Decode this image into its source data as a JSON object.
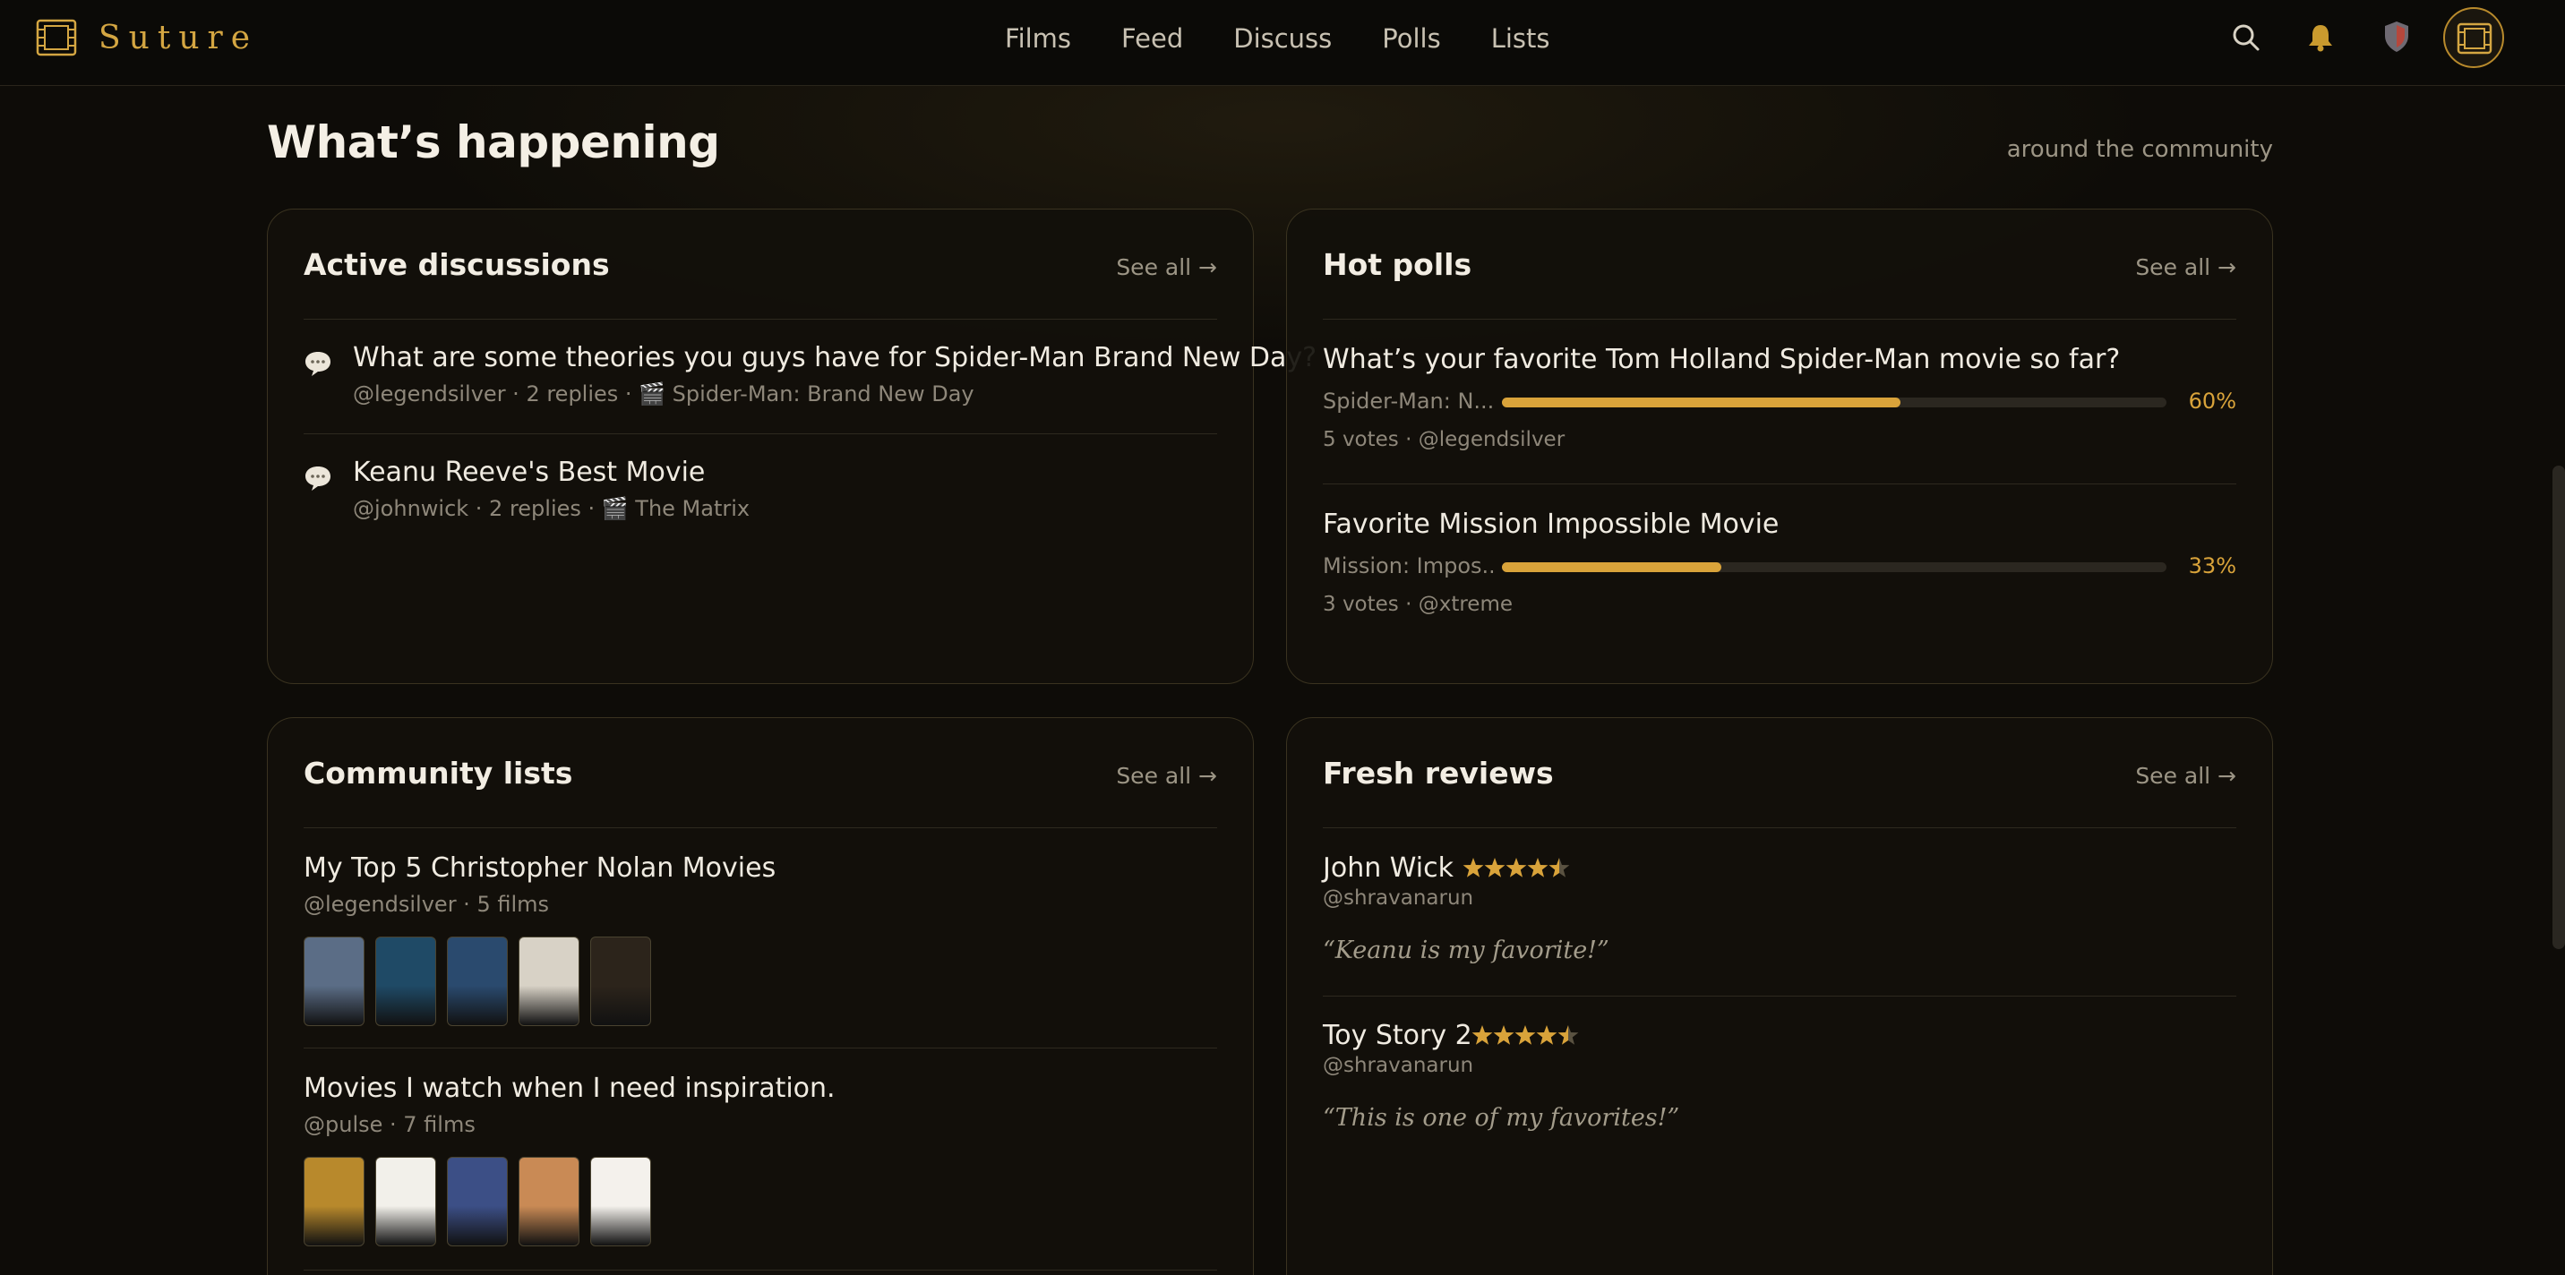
{
  "app": {
    "name": "Suture"
  },
  "nav": {
    "items": [
      "Films",
      "Feed",
      "Discuss",
      "Polls",
      "Lists"
    ]
  },
  "header_icons": [
    "search-icon",
    "bell-icon",
    "shield-icon",
    "avatar-film-icon"
  ],
  "section": {
    "title": "What’s happening",
    "subtitle": "around the community"
  },
  "see_all_label": "See all →",
  "discussions": {
    "title": "Active discussions",
    "items": [
      {
        "title": "What are some theories you guys have for Spider-Man Brand New Day?",
        "meta": "@legendsilver · 2 replies · 🎬 Spider-Man: Brand New Day"
      },
      {
        "title": "Keanu Reeve's Best Movie",
        "meta": "@johnwick · 2 replies · 🎬 The Matrix"
      }
    ]
  },
  "polls": {
    "title": "Hot polls",
    "items": [
      {
        "question": "What’s your favorite Tom Holland Spider-Man movie so far?",
        "option": "Spider-Man: N...",
        "percent": 60,
        "percent_label": "60%",
        "meta": "5 votes · @legendsilver"
      },
      {
        "question": "Favorite Mission Impossible Movie",
        "option": "Mission: Impos...",
        "percent": 33,
        "percent_label": "33%",
        "meta": "3 votes · @xtreme"
      }
    ]
  },
  "lists": {
    "title": "Community lists",
    "items": [
      {
        "title": "My Top 5 Christopher Nolan Movies",
        "meta": "@legendsilver · 5 films",
        "poster_colors": [
          "#5b6d86",
          "#1f4a66",
          "#2a4a6e",
          "#d8d2c6",
          "#2c241b"
        ]
      },
      {
        "title": "Movies I watch when I need inspiration.",
        "meta": "@pulse · 7 films",
        "poster_colors": [
          "#b8892c",
          "#f2f0ea",
          "#3c4f86",
          "#c98a55",
          "#f4f1ec"
        ]
      }
    ]
  },
  "reviews": {
    "title": "Fresh reviews",
    "items": [
      {
        "film": "John Wick",
        "rating": 4.5,
        "user": "@shravanarun",
        "quote": "“Keanu is my favorite!”"
      },
      {
        "film": "Toy Story 2",
        "rating": 4.5,
        "user": "@shravanarun",
        "quote": "“This is one of my favorites!”"
      }
    ]
  },
  "colors": {
    "accent": "#d9a33a",
    "background": "#0e0c08",
    "card_border": "#3a3320"
  }
}
